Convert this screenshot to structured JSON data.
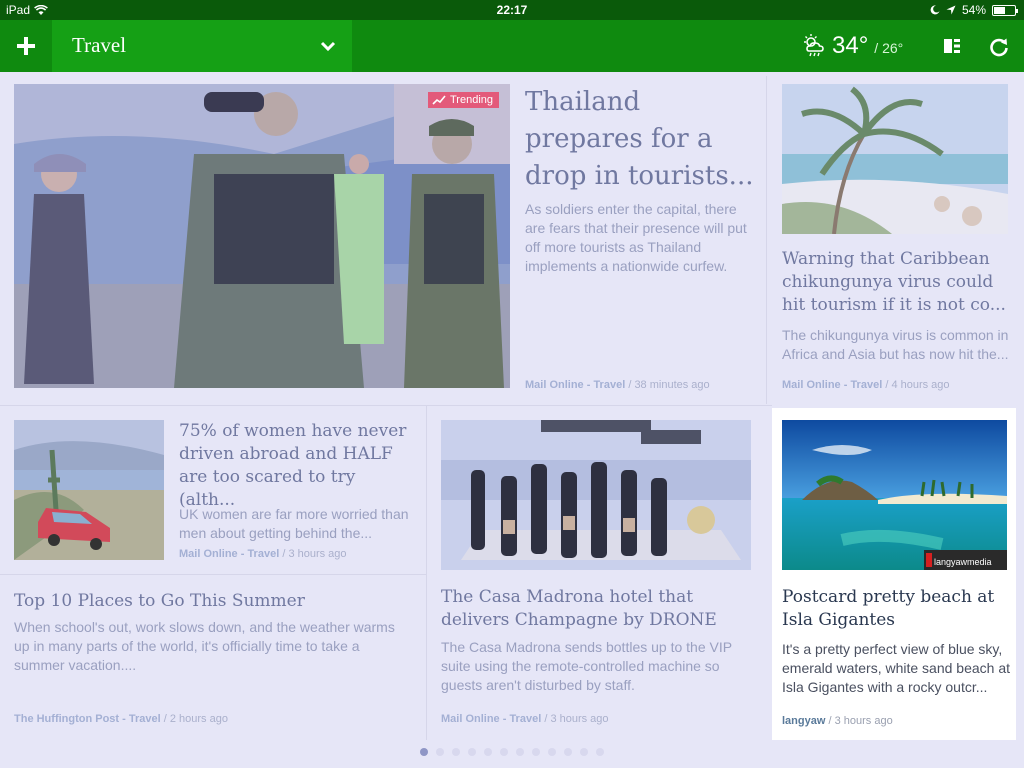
{
  "status_bar": {
    "device": "iPad",
    "time": "22:17",
    "battery": "54%",
    "battery_level": 0.54
  },
  "header": {
    "section": "Travel",
    "weather": {
      "high": "34°",
      "low": "/ 26°",
      "icon": "cloud-rain-sun-icon"
    }
  },
  "articles": [
    {
      "badge": "Trending",
      "title": "Thailand prepares for a drop in tourists...",
      "description": "As soldiers enter the capital, there are fears that their presence will put off more tourists as Thailand implements a nationwide curfew.",
      "source": "Mail Online - Travel",
      "time": "/ 38 minutes ago"
    },
    {
      "title": "Warning that Caribbean chikungunya virus could hit tourism if it is not co...",
      "description": "The chikungunya virus is common in Africa and Asia but has now hit the...",
      "source": "Mail Online - Travel",
      "time": "/ 4 hours ago"
    },
    {
      "title": "75% of women have never driven abroad and HALF are too scared to try (alth...",
      "description": "UK women are far more worried than men about getting behind the...",
      "source": "Mail Online - Travel",
      "time": "/ 3 hours ago"
    },
    {
      "title": "The Casa Madrona hotel that delivers Champagne by DRONE",
      "description": "The Casa Madrona sends bottles up to the VIP suite using the remote-controlled machine so guests aren't disturbed by staff.",
      "source": "Mail Online - Travel",
      "time": "/ 3 hours ago"
    },
    {
      "title": "Top 10 Places to Go This Summer",
      "description": "When school's out, work slows down, and the weather warms up in many parts of the world, it's officially time to take a summer vacation....",
      "source": "The Huffington Post - Travel",
      "time": "/ 2 hours ago"
    },
    {
      "title": "Postcard pretty beach at Isla Gigantes",
      "description": "It's a pretty perfect view of blue sky, emerald waters, white sand beach at Isla Gigantes with a rocky outcr...",
      "source": "langyaw",
      "time": "/ 3 hours ago",
      "image_watermark": "langyawmedia"
    }
  ],
  "pager": {
    "pages": 12,
    "active": 1
  },
  "colors": {
    "header_green": "#0f8a0f",
    "dropdown_green": "#15a015",
    "trending": "#e35a7a"
  }
}
